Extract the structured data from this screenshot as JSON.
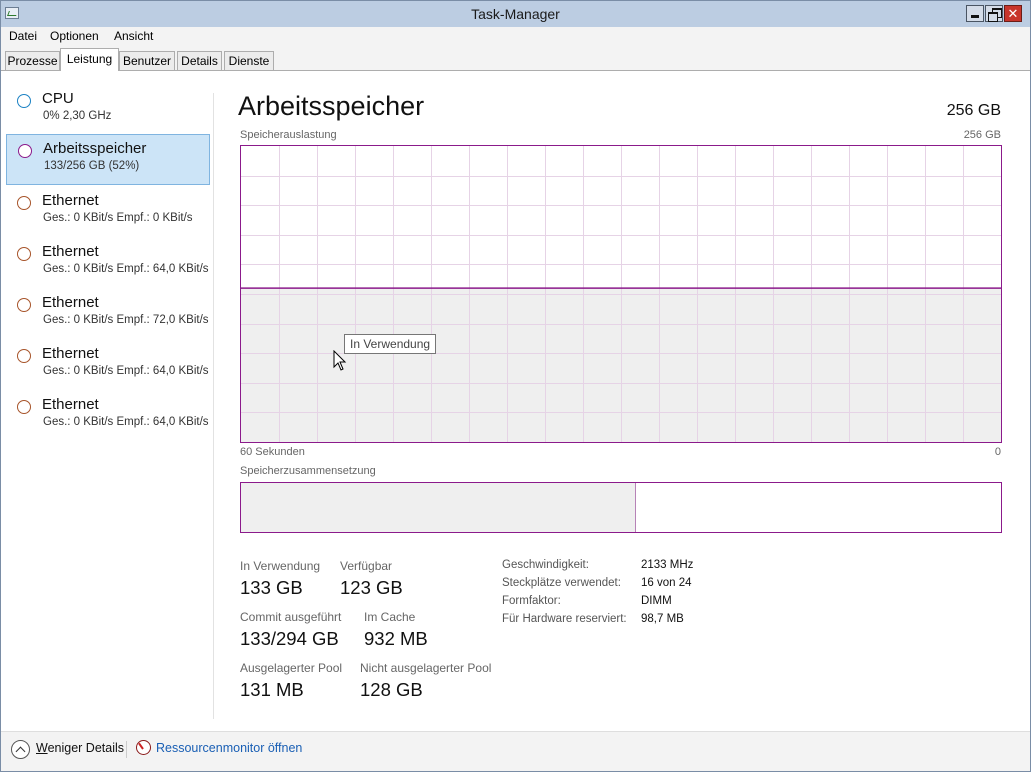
{
  "window": {
    "title": "Task-Manager"
  },
  "menu": [
    "Datei",
    "Optionen",
    "Ansicht"
  ],
  "tabs": [
    "Prozesse",
    "Leistung",
    "Benutzer",
    "Details",
    "Dienste"
  ],
  "active_tab": "Leistung",
  "sidebar": [
    {
      "name": "CPU",
      "sub": "0%  2,30 GHz",
      "color": "#1c82c4",
      "selected": false
    },
    {
      "name": "Arbeitsspeicher",
      "sub": "133/256 GB (52%)",
      "color": "#8b1a8b",
      "selected": true
    },
    {
      "name": "Ethernet",
      "sub": "Ges.: 0 KBit/s  Empf.: 0 KBit/s",
      "color": "#a7542a",
      "selected": false
    },
    {
      "name": "Ethernet",
      "sub": "Ges.: 0 KBit/s  Empf.: 64,0 KBit/s",
      "color": "#a7542a",
      "selected": false
    },
    {
      "name": "Ethernet",
      "sub": "Ges.: 0 KBit/s  Empf.: 72,0 KBit/s",
      "color": "#a7542a",
      "selected": false
    },
    {
      "name": "Ethernet",
      "sub": "Ges.: 0 KBit/s  Empf.: 64,0 KBit/s",
      "color": "#a7542a",
      "selected": false
    },
    {
      "name": "Ethernet",
      "sub": "Ges.: 0 KBit/s  Empf.: 64,0 KBit/s",
      "color": "#a7542a",
      "selected": false
    }
  ],
  "main": {
    "title": "Arbeitsspeicher",
    "total": "256 GB",
    "usage_label": "Speicherauslastung",
    "usage_max": "256 GB",
    "time_left": "60 Sekunden",
    "time_right": "0",
    "usage_fraction": 0.52,
    "composition_label": "Speicherzusammensetzung",
    "composition_in_use_fraction": 0.52,
    "tooltip": "In Verwendung",
    "accent": "#8b1a8b"
  },
  "stats": [
    {
      "label": "In Verwendung",
      "value": "133 GB"
    },
    {
      "label": "Verfügbar",
      "value": "123 GB"
    },
    {
      "label": "Commit ausgeführt",
      "value": "133/294 GB"
    },
    {
      "label": "Im Cache",
      "value": "932 MB"
    },
    {
      "label": "Ausgelagerter Pool",
      "value": "131 MB"
    },
    {
      "label": "Nicht ausgelagerter Pool",
      "value": "128 GB"
    }
  ],
  "details": [
    {
      "label": "Geschwindigkeit:",
      "value": "2133 MHz"
    },
    {
      "label": "Steckplätze verwendet:",
      "value": "16 von 24"
    },
    {
      "label": "Formfaktor:",
      "value": "DIMM"
    },
    {
      "label": "Für Hardware reserviert:",
      "value": "98,7 MB"
    }
  ],
  "footer": {
    "fewer_prefix": "W",
    "fewer_rest": "eniger Details",
    "resmon": "Ressourcenmonitor öffnen"
  }
}
